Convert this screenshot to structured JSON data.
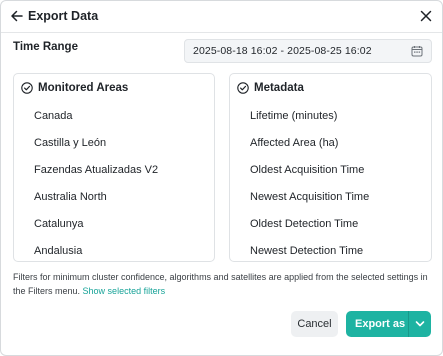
{
  "header": {
    "title": "Export Data"
  },
  "time_range": {
    "label": "Time Range",
    "value": "2025-08-18 16:02 - 2025-08-25 16:02"
  },
  "monitored_areas": {
    "title": "Monitored Areas",
    "items": [
      "Canada",
      "Castilla y León",
      "Fazendas Atualizadas V2",
      "Australia North",
      "Catalunya",
      "Andalusia"
    ]
  },
  "metadata": {
    "title": "Metadata",
    "items": [
      "Lifetime (minutes)",
      "Affected Area (ha)",
      "Oldest Acquisition Time",
      "Newest Acquisition Time",
      "Oldest Detection Time",
      "Newest Detection Time"
    ]
  },
  "note": {
    "text": "Filters for minimum cluster confidence, algorithms and satellites are applied from the selected settings in the Filters menu.",
    "link": "Show selected filters"
  },
  "actions": {
    "cancel": "Cancel",
    "export": "Export as"
  },
  "icons": {
    "back": "arrow-left-icon",
    "close": "close-icon",
    "calendar": "calendar-icon",
    "check": "check-circle-icon",
    "chevron": "chevron-down-icon"
  },
  "colors": {
    "accent": "#1eb3a2",
    "link": "#17a398"
  }
}
